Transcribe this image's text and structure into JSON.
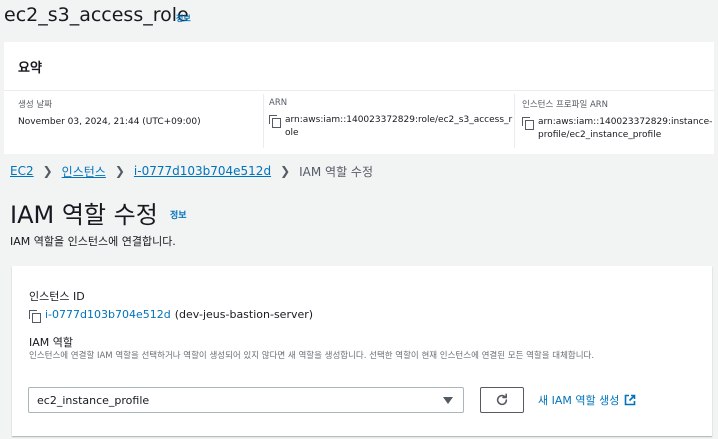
{
  "role": {
    "name": "ec2_s3_access_role",
    "info_label": "정보",
    "summary": {
      "heading": "요약",
      "created_label": "생성 날짜",
      "created_value": "November 03, 2024, 21:44 (UTC+09:00)",
      "arn_label": "ARN",
      "arn_value_line1": "arn:aws:iam::140023372829:role/ec2_s3_access_r",
      "arn_value_line2": "ole",
      "profile_label": "인스턴스 프로파일 ARN",
      "profile_value_line1": "arn:aws:iam::140023372829:instance-",
      "profile_value_line2": "profile/ec2_instance_profile"
    }
  },
  "breadcrumb": {
    "ec2": "EC2",
    "instances": "인스턴스",
    "instance": "i-0777d103b704e512d",
    "current": "IAM 역할 수정"
  },
  "page": {
    "title": "IAM 역할 수정",
    "info_label": "정보",
    "description": "IAM 역할을 인스턴스에 연결합니다."
  },
  "form": {
    "instance_label": "인스턴스 ID",
    "instance_id": "i-0777d103b704e512d",
    "instance_name": "(dev-jeus-bastion-server)",
    "role_label": "IAM 역할",
    "role_description": "인스턴스에 연결할 IAM 역할을 선택하거나 역할이 생성되어 있지 않다면 새 역할을 생성합니다. 선택한 역할이 현재 인스턴스에 연결된 모든 역할을 대체합니다.",
    "selected_role": "ec2_instance_profile",
    "create_role_label": "새 IAM 역할 생성"
  },
  "colors": {
    "link": "#0073bb",
    "background": "#f2f3f3",
    "text": "#16191f",
    "muted": "#545b64"
  },
  "icons": [
    "copy-icon",
    "chevron-right-icon",
    "caret-down-icon",
    "refresh-icon",
    "external-link-icon"
  ]
}
